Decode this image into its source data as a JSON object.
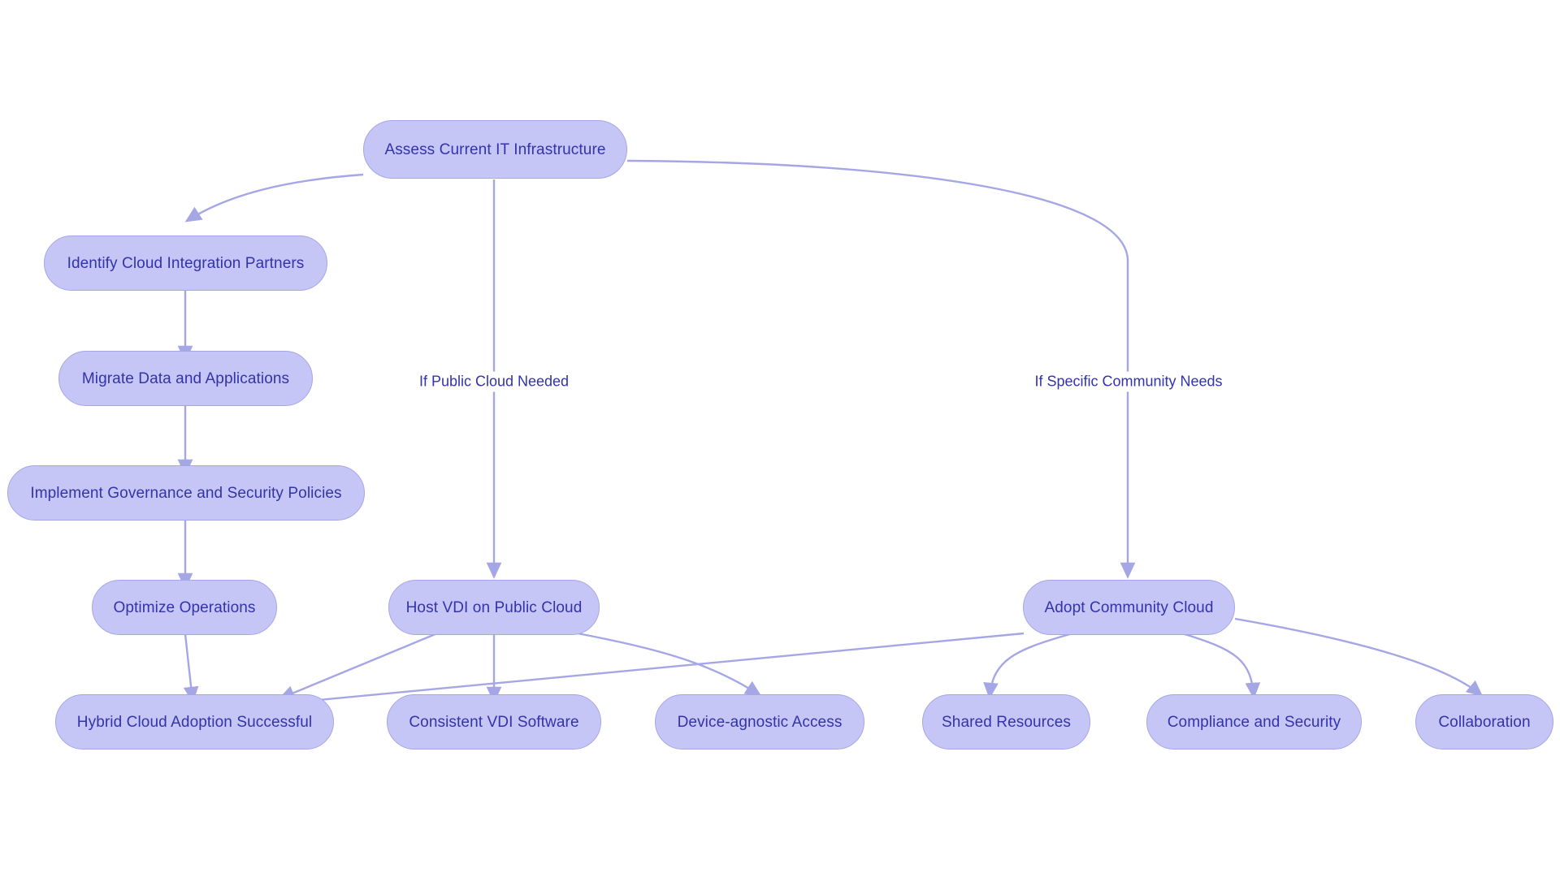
{
  "diagram": {
    "type": "flowchart",
    "orientation": "top-down",
    "background_color": "#ffffff",
    "node_fill_color": "#c5c6f5",
    "node_border_color": "#a5a6e6",
    "node_text_color": "#3333aa",
    "edge_color": "#a5a6e6",
    "nodes": [
      {
        "id": "assess",
        "label": "Assess Current IT Infrastructure"
      },
      {
        "id": "identify",
        "label": "Identify Cloud Integration Partners"
      },
      {
        "id": "migrate",
        "label": "Migrate Data and Applications"
      },
      {
        "id": "governance",
        "label": "Implement Governance and Security Policies"
      },
      {
        "id": "optimize",
        "label": "Optimize Operations"
      },
      {
        "id": "hybrid",
        "label": "Hybrid Cloud Adoption Successful"
      },
      {
        "id": "hostvdi",
        "label": "Host VDI on Public Cloud"
      },
      {
        "id": "consistent",
        "label": "Consistent VDI Software"
      },
      {
        "id": "device",
        "label": "Device-agnostic Access"
      },
      {
        "id": "community",
        "label": "Adopt Community Cloud"
      },
      {
        "id": "shared",
        "label": "Shared Resources"
      },
      {
        "id": "compliance",
        "label": "Compliance and Security"
      },
      {
        "id": "collab",
        "label": "Collaboration"
      }
    ],
    "edge_labels": [
      {
        "id": "public-cloud-needed",
        "label": "If Public Cloud Needed"
      },
      {
        "id": "community-needs",
        "label": "If Specific Community Needs"
      }
    ],
    "edges": [
      {
        "from": "assess",
        "to": "identify",
        "label": ""
      },
      {
        "from": "assess",
        "to": "hostvdi",
        "label": "If Public Cloud Needed"
      },
      {
        "from": "assess",
        "to": "community",
        "label": "If Specific Community Needs"
      },
      {
        "from": "identify",
        "to": "migrate",
        "label": ""
      },
      {
        "from": "migrate",
        "to": "governance",
        "label": ""
      },
      {
        "from": "governance",
        "to": "optimize",
        "label": ""
      },
      {
        "from": "optimize",
        "to": "hybrid",
        "label": ""
      },
      {
        "from": "hostvdi",
        "to": "hybrid",
        "label": ""
      },
      {
        "from": "hostvdi",
        "to": "consistent",
        "label": ""
      },
      {
        "from": "hostvdi",
        "to": "device",
        "label": ""
      },
      {
        "from": "community",
        "to": "hybrid",
        "label": ""
      },
      {
        "from": "community",
        "to": "shared",
        "label": ""
      },
      {
        "from": "community",
        "to": "compliance",
        "label": ""
      },
      {
        "from": "community",
        "to": "collab",
        "label": ""
      }
    ]
  }
}
